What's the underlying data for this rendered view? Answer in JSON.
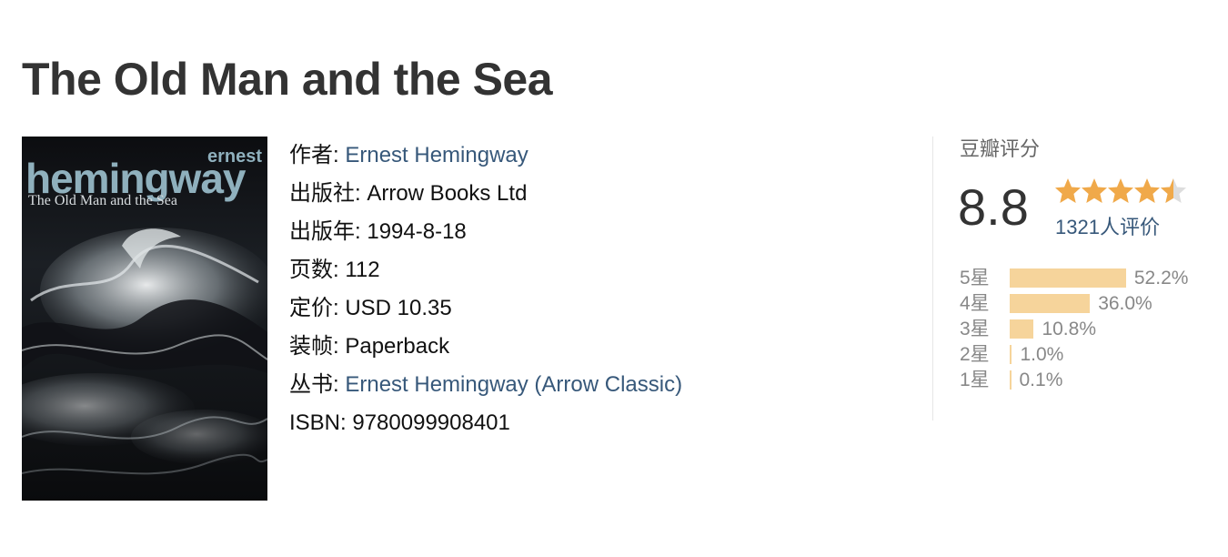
{
  "book": {
    "title": "The Old Man and the Sea",
    "cover": {
      "author_first": "ernest",
      "author_last": "hemingway",
      "title": "The Old Man and the Sea"
    },
    "info": [
      {
        "label": "作者:",
        "value": "Ernest Hemingway",
        "link": true
      },
      {
        "label": "出版社:",
        "value": "Arrow Books Ltd",
        "link": false
      },
      {
        "label": "出版年:",
        "value": "1994-8-18",
        "link": false
      },
      {
        "label": "页数:",
        "value": "112",
        "link": false
      },
      {
        "label": "定价:",
        "value": "USD 10.35",
        "link": false
      },
      {
        "label": "装帧:",
        "value": "Paperback",
        "link": false
      },
      {
        "label": "丛书:",
        "value": "Ernest Hemingway (Arrow Classic)",
        "link": true
      },
      {
        "label": "ISBN:",
        "value": "9780099908401",
        "link": false
      }
    ]
  },
  "rating": {
    "heading": "豆瓣评分",
    "score": "8.8",
    "stars": 4.5,
    "count": "1321人评价",
    "distribution": [
      {
        "label": "5星",
        "percent": 52.2,
        "display": "52.2%"
      },
      {
        "label": "4星",
        "percent": 36.0,
        "display": "36.0%"
      },
      {
        "label": "3星",
        "percent": 10.8,
        "display": "10.8%"
      },
      {
        "label": "2星",
        "percent": 1.0,
        "display": "1.0%"
      },
      {
        "label": "1星",
        "percent": 0.1,
        "display": "0.1%"
      }
    ]
  },
  "colors": {
    "link": "#37587a",
    "star": "#f0a94a",
    "star_empty": "#dddddd",
    "bar": "#f6d49b",
    "cover_text": "#8fb0bd"
  }
}
